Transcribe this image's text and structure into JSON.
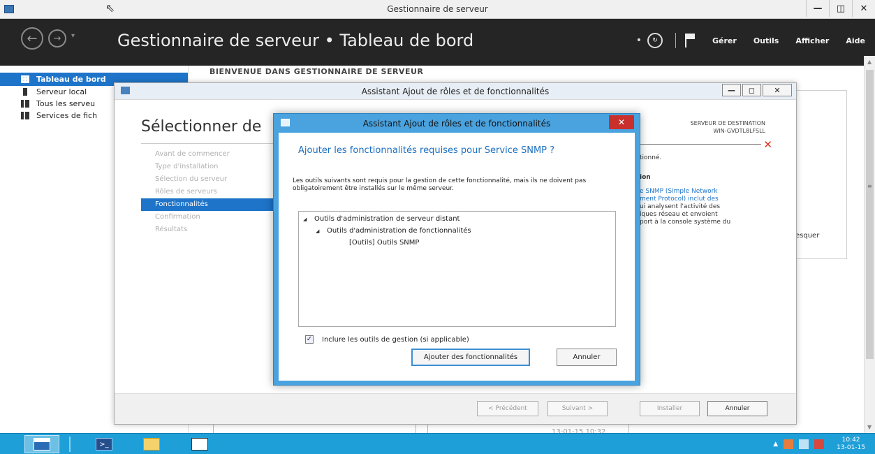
{
  "window": {
    "title": "Gestionnaire de serveur",
    "controls": [
      "—",
      "◫",
      "✕"
    ]
  },
  "header": {
    "title": "Gestionnaire de serveur • Tableau de bord",
    "menus": [
      "Gérer",
      "Outils",
      "Afficher",
      "Aide"
    ]
  },
  "sidebar": {
    "items": [
      {
        "label": "Tableau de bord"
      },
      {
        "label": "Serveur local"
      },
      {
        "label": "Tous les serveu"
      },
      {
        "label": "Services de fich"
      }
    ]
  },
  "main": {
    "welcome": "BIENVENUE DANS GESTIONNAIRE DE SERVEUR",
    "right_fragment": "esquer",
    "date_fragment": "13-01-15 10:32"
  },
  "wizard": {
    "title": "Assistant Ajout de rôles et de fonctionnalités",
    "heading": "Sélectionner de",
    "dest_label": "SERVEUR DE DESTINATION",
    "dest_server": "WIN-GVDTL8LFSLL",
    "nav": [
      {
        "label": "Avant de commencer"
      },
      {
        "label": "Type d'installation"
      },
      {
        "label": "Sélection du serveur"
      },
      {
        "label": "Rôles de serveurs"
      },
      {
        "label": "Fonctionnalités"
      },
      {
        "label": "Confirmation"
      },
      {
        "label": "Résultats"
      }
    ],
    "right_text_1": "tionné.",
    "right_text_2": "ion",
    "right_text_3a": "e SNMP (Simple Network",
    "right_text_3b": "ment Protocol) inclut des",
    "right_text_4": "ui analysent l'activité des",
    "right_text_5": "iques réseau et envoient",
    "right_text_6": "port à la console système du",
    "buttons": {
      "prev": "< Précédent",
      "next": "Suivant >",
      "install": "Installer",
      "cancel": "Annuler"
    }
  },
  "modal": {
    "title": "Assistant Ajout de rôles et de fonctionnalités",
    "heading": "Ajouter les fonctionnalités requises pour Service SNMP ?",
    "description": "Les outils suivants sont requis pour la gestion de cette fonctionnalité, mais ils ne doivent pas obligatoirement être installés sur le même serveur.",
    "tree": [
      {
        "label": "Outils d'administration de serveur distant"
      },
      {
        "label": "Outils d'administration de fonctionnalités"
      },
      {
        "label": "[Outils] Outils SNMP"
      }
    ],
    "checkbox_label": "Inclure les outils de gestion (si applicable)",
    "checkbox_checked": true,
    "add_button": "Ajouter des fonctionnalités",
    "cancel_button": "Annuler"
  },
  "taskbar": {
    "clock_time": "10:42",
    "clock_date": "13-01-15"
  },
  "colors": {
    "accent": "#1e74c9",
    "header_bg": "#252525",
    "modal_border": "#4aa3df",
    "taskbar": "#1f9fd8",
    "close_red": "#c9302c"
  }
}
